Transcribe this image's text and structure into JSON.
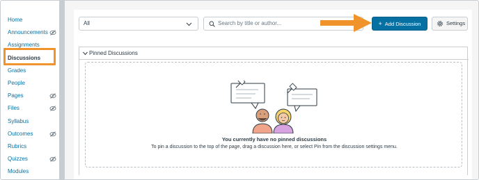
{
  "sidebar": {
    "items": [
      {
        "label": "Home"
      },
      {
        "label": "Announcements"
      },
      {
        "label": "Assignments"
      },
      {
        "label": "Discussions"
      },
      {
        "label": "Grades"
      },
      {
        "label": "People"
      },
      {
        "label": "Pages"
      },
      {
        "label": "Files"
      },
      {
        "label": "Syllabus"
      },
      {
        "label": "Outcomes"
      },
      {
        "label": "Rubrics"
      },
      {
        "label": "Quizzes"
      },
      {
        "label": "Modules"
      }
    ]
  },
  "toolbar": {
    "filter_value": "All",
    "search_placeholder": "Search by title or author...",
    "add_label": "Add Discussion",
    "add_plus": "+",
    "settings_label": "Settings"
  },
  "pinned": {
    "header": "Pinned Discussions",
    "empty_title": "You currently have no pinned discussions",
    "empty_desc": "To pin a discussion to the top of the page, drag a discussion here, or select Pin from the discussion settings menu."
  },
  "colors": {
    "link": "#0770a3",
    "primary_button": "#0770a3",
    "annotation": "#f0932b"
  }
}
